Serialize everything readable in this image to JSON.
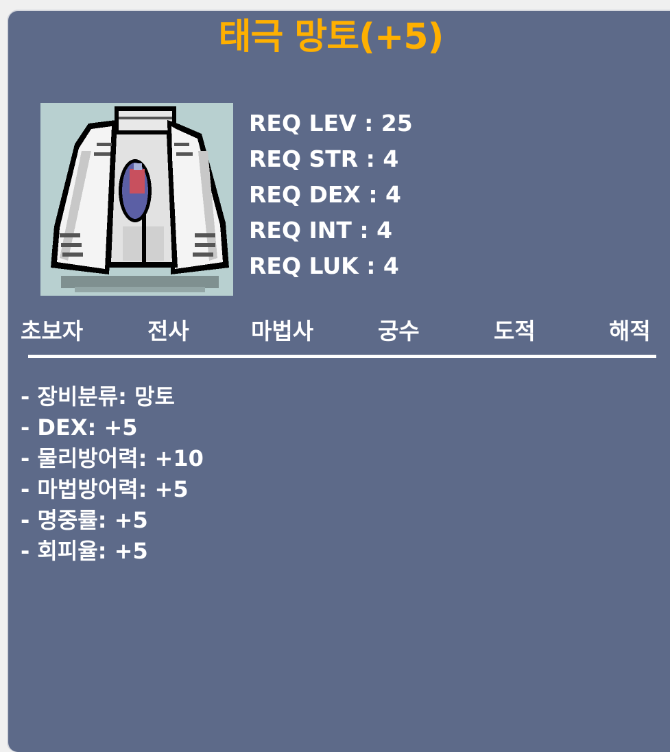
{
  "item": {
    "name": "태극 망토(+5)",
    "image_icon": "white-cape-icon",
    "name_color": "#ffb000",
    "panel_color": "#5d6a89"
  },
  "requirements": [
    "REQ LEV : 25",
    "REQ STR : 4",
    "REQ DEX : 4",
    "REQ INT : 4",
    "REQ LUK : 4"
  ],
  "jobs": [
    "초보자",
    "전사",
    "마법사",
    "궁수",
    "도적",
    "해적"
  ],
  "stats": [
    "- 장비분류: 망토",
    "- DEX: +5",
    "- 물리방어력: +10",
    "- 마법방어력: +5",
    "- 명중률: +5",
    "- 회피율: +5"
  ]
}
